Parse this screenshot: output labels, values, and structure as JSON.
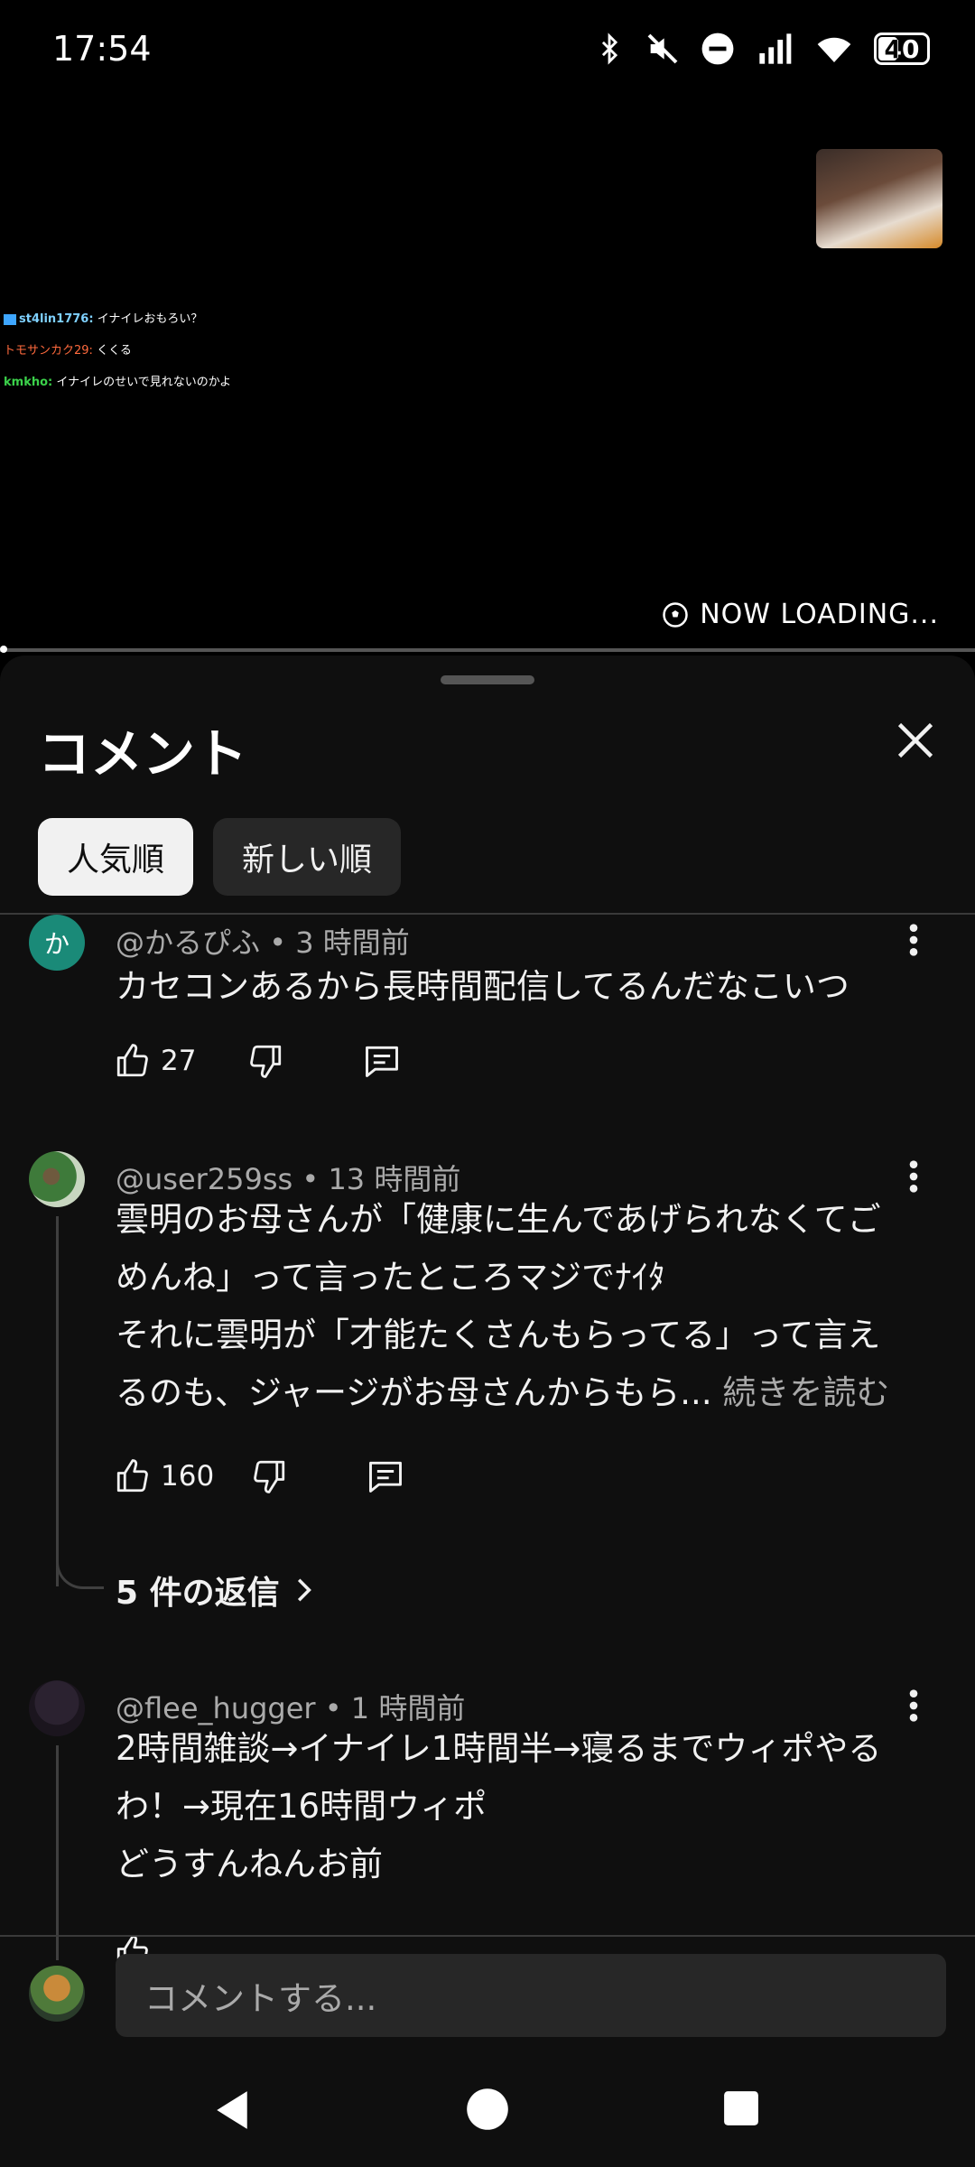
{
  "status_bar": {
    "time": "17:54",
    "battery": "40"
  },
  "video": {
    "chat": [
      {
        "user": "st4lin1776:",
        "message": "イナイレおもろい？"
      },
      {
        "user": "トモサンカク29:",
        "message": "くくる"
      },
      {
        "user": "kmkho:",
        "message": "イナイレのせいで見れないのかよ"
      }
    ],
    "overlay_text": "NOW LOADING..."
  },
  "sheet": {
    "title": "コメント",
    "sort_chips": [
      {
        "label": "人気順",
        "active": true
      },
      {
        "label": "新しい順",
        "active": false
      }
    ]
  },
  "comments": [
    {
      "avatar_letter": "か",
      "avatar_color": "#1a8a78",
      "author": "@かるぴふ",
      "time": "3 時間前",
      "lines": [
        "カセコンあるから長時間配信してるんだなこいつ"
      ],
      "likes": "27"
    },
    {
      "author": "@user259ss",
      "time": "13 時間前",
      "lines": [
        "雲明のお母さんが「健康に生んであげられなくてご",
        "めんね」って言ったところマジでﾅｲﾀ",
        "それに雲明が「才能たくさんもらってる」って言え",
        "るのも、ジャージがお母さんからもら..."
      ],
      "read_more": "続きを読む",
      "likes": "160",
      "replies": "5 件の返信"
    },
    {
      "author": "@flee_hugger",
      "time": "1 時間前",
      "lines": [
        "2時間雑談→イナイレ1時間半→寝るまでウィポやる",
        "わ！→現在16時間ウィポ",
        "どうすんねんお前"
      ]
    }
  ],
  "composer": {
    "placeholder": "コメントする..."
  }
}
